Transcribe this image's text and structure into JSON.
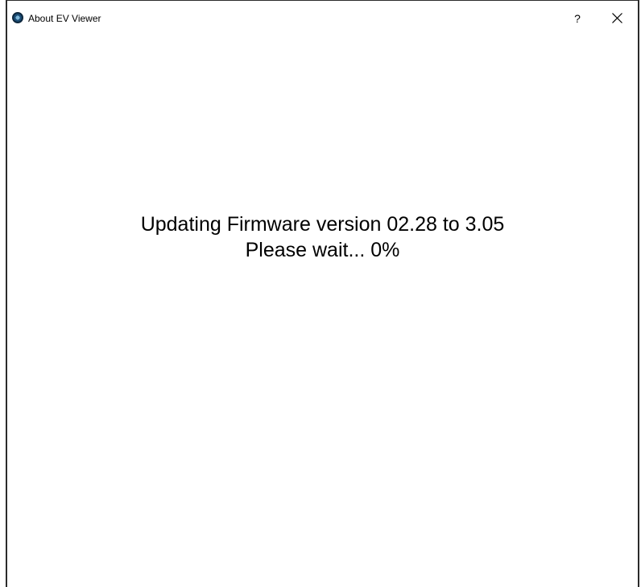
{
  "window": {
    "title": "About EV Viewer",
    "app_icon": "ev-viewer-app-icon",
    "help_label": "?",
    "close_icon": "close-icon"
  },
  "message": {
    "line1": "Updating Firmware version 02.28 to 3.05",
    "line2": "Please wait... 0%",
    "from_version": "02.28",
    "to_version": "3.05",
    "progress_percent": 0
  }
}
